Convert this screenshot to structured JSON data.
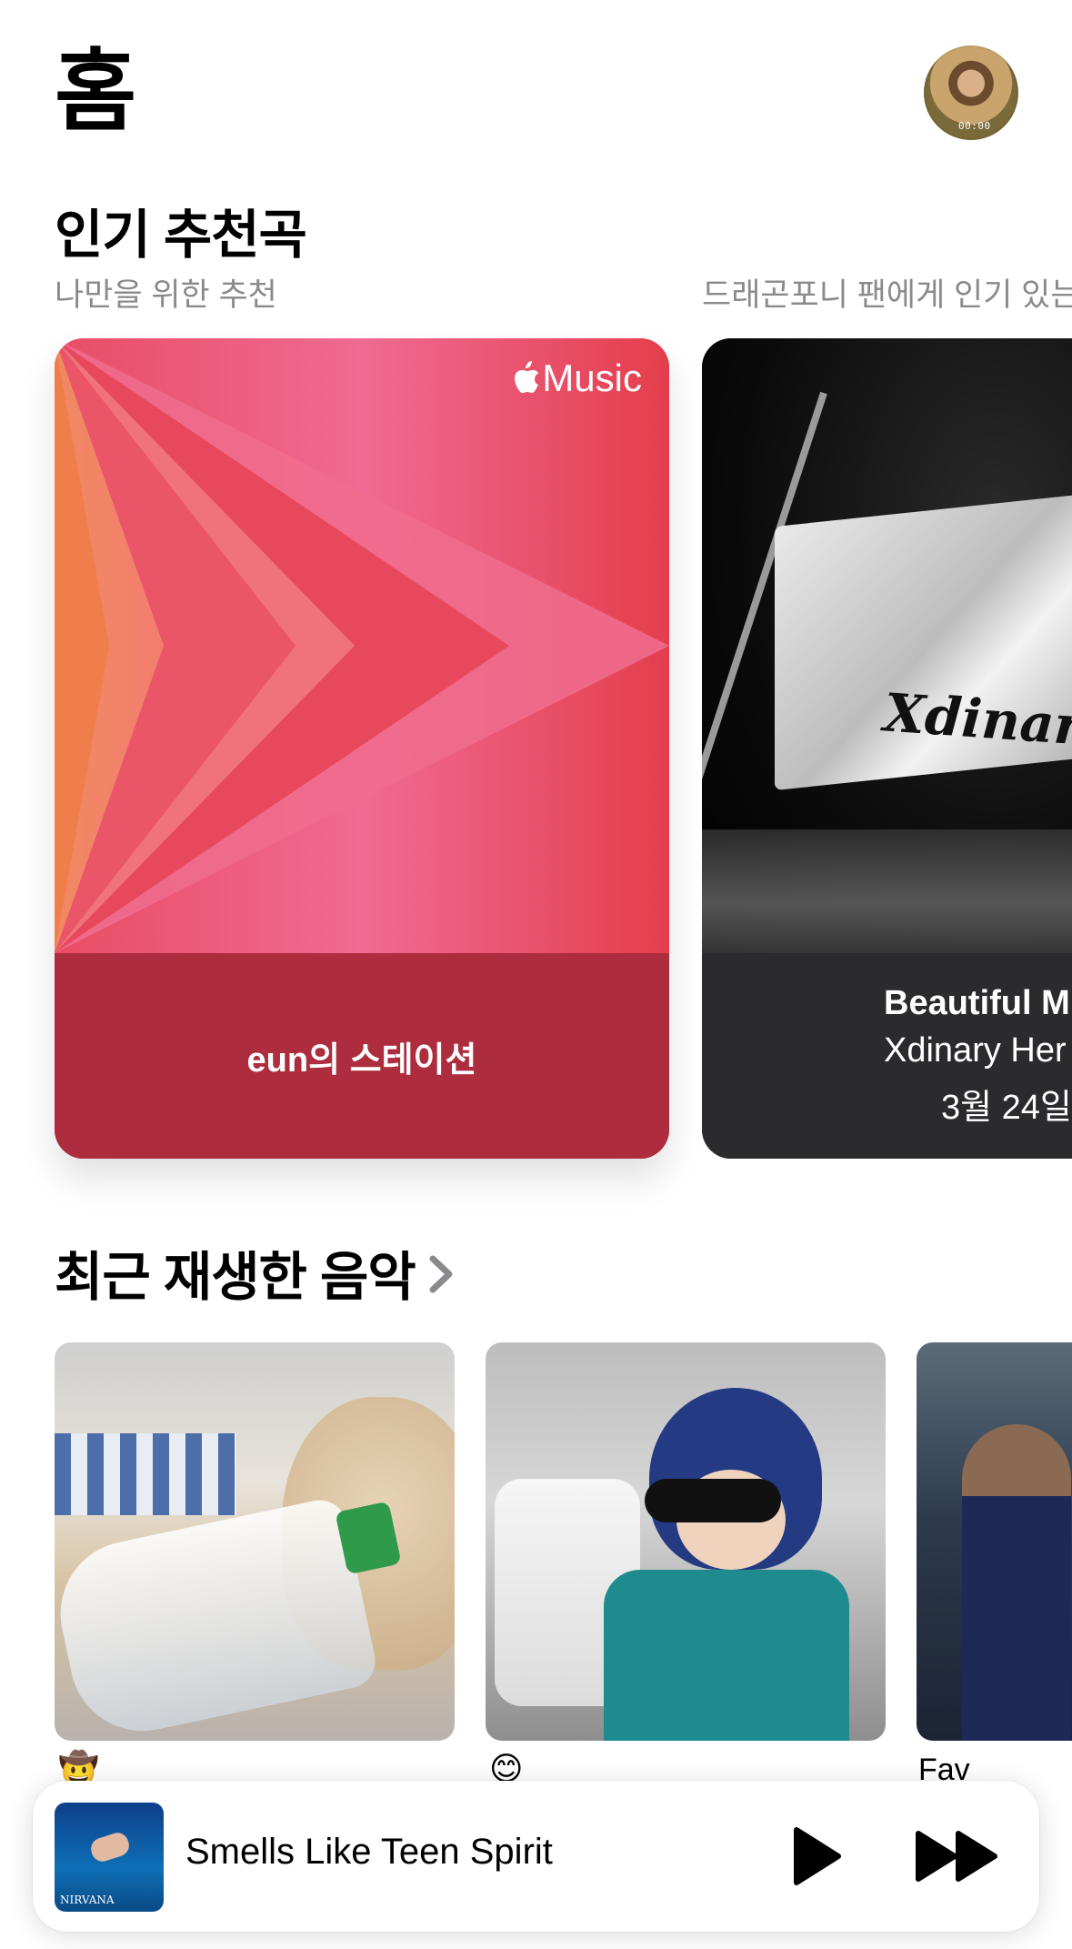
{
  "header": {
    "title": "홈"
  },
  "sections": {
    "top_picks": {
      "title": "인기 추천곡",
      "sub_left": "나만을 위한 추천",
      "sub_right": "드래곤포니 팬에게 인기 있는"
    },
    "recently_played": {
      "title": "최근 재생한 음악"
    }
  },
  "cards": {
    "station": {
      "badge": "Music",
      "name": "eun의 스테이션"
    },
    "album": {
      "cover_text": "Xdinary He",
      "title": "Beautiful M",
      "artist": "Xdinary Her",
      "date": "3월 24일"
    }
  },
  "recent": [
    {
      "caption": "🤠"
    },
    {
      "caption": "😊"
    },
    {
      "caption": "Fav"
    }
  ],
  "avatar": {
    "overlay_text": "00:00"
  },
  "player": {
    "track": "Smells Like Teen Spirit",
    "art_text": "NIRVANA"
  },
  "colors": {
    "station_top": "#e8515f",
    "station_bottom": "#ad2d3e",
    "album_card": "#2b2b2d",
    "accent": "#000000"
  },
  "icons": [
    "apple-logo-icon",
    "chevron-right-icon",
    "play-icon",
    "fast-forward-icon"
  ]
}
